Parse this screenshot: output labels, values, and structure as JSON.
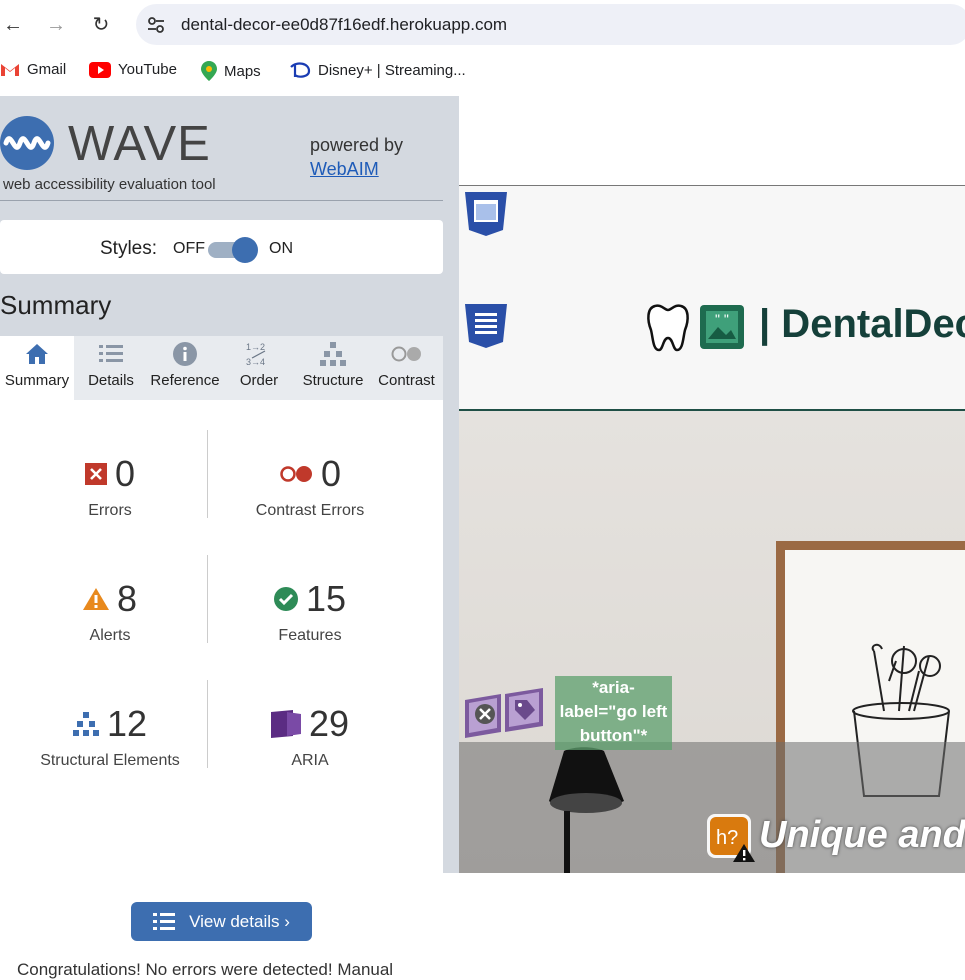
{
  "browser": {
    "url": "dental-decor-ee0d87f16edf.herokuapp.com",
    "bookmarks": [
      "Gmail",
      "YouTube",
      "Maps",
      "Disney+ | Streaming..."
    ]
  },
  "wave": {
    "title": "WAVE",
    "subtitle": "web accessibility evaluation tool",
    "powered_by": "powered by",
    "webaim": "WebAIM",
    "styles_label": "Styles:",
    "off": "OFF",
    "on": "ON",
    "styles_state": "on",
    "summary_heading": "Summary",
    "tabs": [
      {
        "label": "Summary",
        "icon": "home-icon"
      },
      {
        "label": "Details",
        "icon": "list-icon"
      },
      {
        "label": "Reference",
        "icon": "info-icon"
      },
      {
        "label": "Order",
        "icon": "order-icon"
      },
      {
        "label": "Structure",
        "icon": "structure-icon"
      },
      {
        "label": "Contrast",
        "icon": "contrast-icon"
      }
    ],
    "stats": {
      "errors": {
        "value": "0",
        "label": "Errors"
      },
      "contrast_errors": {
        "value": "0",
        "label": "Contrast Errors"
      },
      "alerts": {
        "value": "8",
        "label": "Alerts"
      },
      "features": {
        "value": "15",
        "label": "Features"
      },
      "structural": {
        "value": "12",
        "label": "Structural Elements"
      },
      "aria": {
        "value": "29",
        "label": "ARIA"
      }
    },
    "view_details": "View details ›",
    "congrats": "Congratulations! No errors were detected! Manual"
  },
  "page": {
    "brand": "| DentalDec",
    "aria_annotation": "*aria-label=\"go left button\"*",
    "tagline": "Unique and",
    "heading_badge": "h?"
  },
  "colors": {
    "wave_blue": "#3d6eb0",
    "error_red": "#c0392b",
    "alert_orange": "#e8891d",
    "feature_green": "#2e8b57",
    "aria_purple": "#5b2c83",
    "brand_green": "#15403a"
  }
}
